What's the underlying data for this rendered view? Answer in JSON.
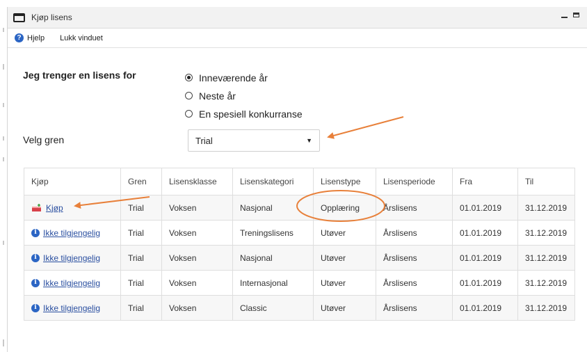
{
  "window": {
    "title": "Kjøp lisens"
  },
  "menu": {
    "help_label": "Hjelp",
    "close_label": "Lukk vinduet"
  },
  "form": {
    "license_for_label": "Jeg trenger en lisens for",
    "options": [
      {
        "label": "Inneværende år",
        "checked": true
      },
      {
        "label": "Neste år",
        "checked": false
      },
      {
        "label": "En spesiell konkurranse",
        "checked": false
      }
    ],
    "branch_label": "Velg gren",
    "branch_value": "Trial"
  },
  "table": {
    "headers": [
      "Kjøp",
      "Gren",
      "Lisensklasse",
      "Lisenskategori",
      "Lisenstype",
      "Lisensperiode",
      "Fra",
      "Til"
    ],
    "rows": [
      {
        "buy": "Kjøp",
        "buy_icon": "cart-add-icon",
        "gren": "Trial",
        "klasse": "Voksen",
        "kategori": "Nasjonal",
        "type": "Opplæring",
        "periode": "Årslisens",
        "fra": "01.01.2019",
        "til": "31.12.2019"
      },
      {
        "buy": "Ikke tilgjengelig",
        "buy_icon": "info-icon",
        "gren": "Trial",
        "klasse": "Voksen",
        "kategori": "Treningslisens",
        "type": "Utøver",
        "periode": "Årslisens",
        "fra": "01.01.2019",
        "til": "31.12.2019"
      },
      {
        "buy": "Ikke tilgjengelig",
        "buy_icon": "info-icon",
        "gren": "Trial",
        "klasse": "Voksen",
        "kategori": "Nasjonal",
        "type": "Utøver",
        "periode": "Årslisens",
        "fra": "01.01.2019",
        "til": "31.12.2019"
      },
      {
        "buy": "Ikke tilgjengelig",
        "buy_icon": "info-icon",
        "gren": "Trial",
        "klasse": "Voksen",
        "kategori": "Internasjonal",
        "type": "Utøver",
        "periode": "Årslisens",
        "fra": "01.01.2019",
        "til": "31.12.2019"
      },
      {
        "buy": "Ikke tilgjengelig",
        "buy_icon": "info-icon",
        "gren": "Trial",
        "klasse": "Voksen",
        "kategori": "Classic",
        "type": "Utøver",
        "periode": "Årslisens",
        "fra": "01.01.2019",
        "til": "31.12.2019"
      }
    ]
  },
  "colors": {
    "annotation": "#e8803a",
    "link": "#2a4fa0",
    "info_icon": "#2b65c4",
    "row_alt": "#f7f7f7"
  }
}
